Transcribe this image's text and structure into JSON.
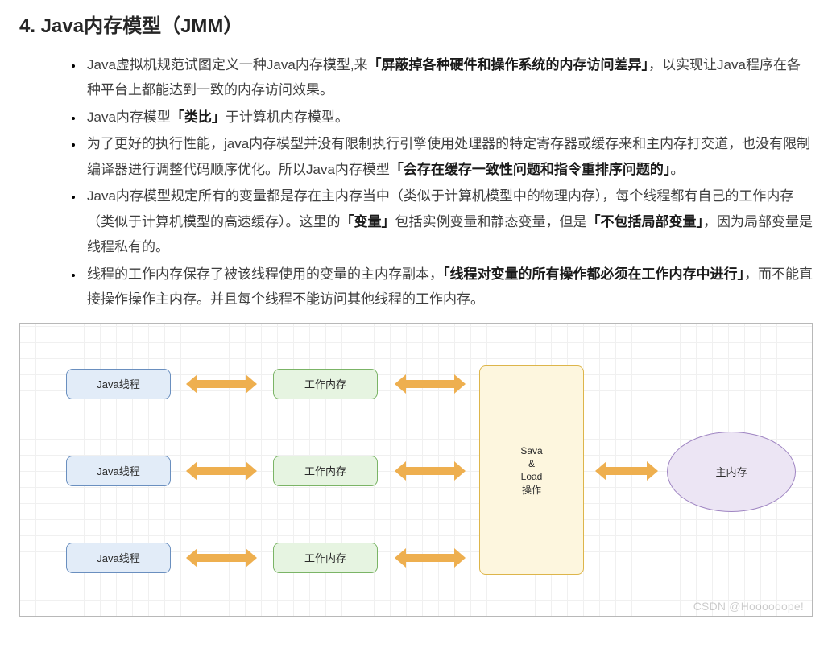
{
  "title": "4. Java内存模型（JMM）",
  "bullets": [
    {
      "pre": "Java虚拟机规范试图定义一种Java内存模型,来",
      "bold": "「屏蔽掉各种硬件和操作系统的内存访问差异」",
      "post": "，以实现让Java程序在各种平台上都能达到一致的内存访问效果。"
    },
    {
      "pre": "Java内存模型",
      "bold": "「类比」",
      "post": "于计算机内存模型。"
    },
    {
      "pre": "为了更好的执行性能，java内存模型并没有限制执行引擎使用处理器的特定寄存器或缓存来和主内存打交道，也没有限制编译器进行调整代码顺序优化。所以Java内存模型",
      "bold": "「会存在缓存一致性问题和指令重排序问题的」",
      "post": "。"
    },
    {
      "pre": "Java内存模型规定所有的变量都是存在主内存当中（类似于计算机模型中的物理内存），每个线程都有自己的工作内存（类似于计算机模型的高速缓存）。这里的",
      "bold": "「变量」",
      "post": "包括实例变量和静态变量，但是",
      "bold2": "「不包括局部变量」",
      "post2": "，因为局部变量是线程私有的。"
    },
    {
      "pre": "线程的工作内存保存了被该线程使用的变量的主内存副本，",
      "bold": "「线程对变量的所有操作都必须在工作内存中进行」",
      "post": "，而不能直接操作操作主内存。并且每个线程不能访问其他线程的工作内存。"
    }
  ],
  "diagram": {
    "thread_label": "Java线程",
    "work_label": "工作内存",
    "op_label": "Sava\n&\nLoad\n操作",
    "main_mem_label": "主内存"
  },
  "watermark": "CSDN @Hoooooope!"
}
